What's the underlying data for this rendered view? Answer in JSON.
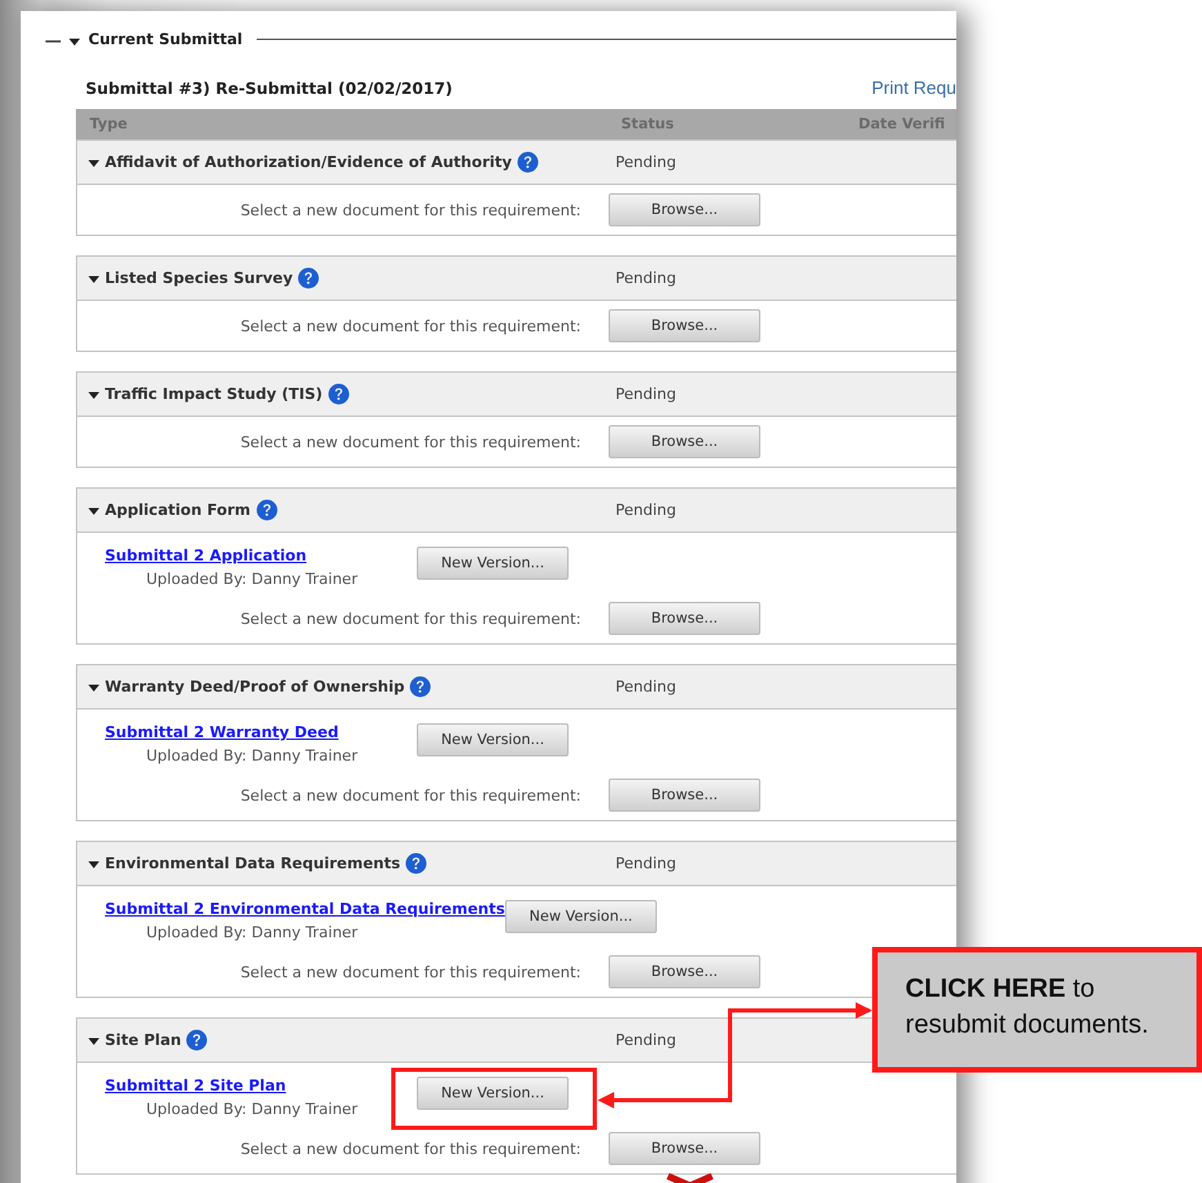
{
  "section": {
    "title": "Current Submittal",
    "expanded": true
  },
  "submittal_title": "Submittal #3) Re-Submittal (02/02/2017)",
  "print_link": "Print Requ",
  "columns": [
    "Type",
    "Status",
    "Date Verifi"
  ],
  "requirements": [
    {
      "name": "Affidavit of Authorization/Evidence of Authority",
      "status": "Pending",
      "expanded": true,
      "select_label": "Select a new document for this requirement:",
      "browse_button": "Browse..."
    },
    {
      "name": "Listed Species Survey",
      "status": "Pending",
      "expanded": true,
      "select_label": "Select a new document for this requirement:",
      "browse_button": "Browse..."
    },
    {
      "name": "Traffic Impact Study (TIS)",
      "status": "Pending",
      "expanded": true,
      "select_label": "Select a new document for this requirement:",
      "browse_button": "Browse..."
    },
    {
      "name": "Application Form",
      "status": "Pending",
      "expanded": true,
      "documents": [
        {
          "link": "Submittal 2 Application",
          "uploaded_by": "Uploaded By: Danny Trainer",
          "button": "New Version..."
        }
      ],
      "select_label": "Select a new document for this requirement:",
      "browse_button": "Browse..."
    },
    {
      "name": "Warranty Deed/Proof of Ownership",
      "status": "Pending",
      "expanded": true,
      "documents": [
        {
          "link": "Submittal 2 Warranty Deed",
          "uploaded_by": "Uploaded By: Danny Trainer",
          "button": "New Version..."
        }
      ],
      "select_label": "Select a new document for this requirement:",
      "browse_button": "Browse..."
    },
    {
      "name": "Environmental Data Requirements",
      "status": "Pending",
      "expanded": true,
      "documents": [
        {
          "link": "Submittal 2 Environmental Data Requirements",
          "uploaded_by": "Uploaded By: Danny Trainer",
          "button": "New Version..."
        }
      ],
      "select_label": "Select a new document for this requirement:",
      "browse_button": "Browse..."
    },
    {
      "name": "Site Plan",
      "status": "Pending",
      "expanded": true,
      "documents": [
        {
          "link": "Submittal 2 Site Plan",
          "uploaded_by": "Uploaded By: Danny Trainer",
          "button": "New Version..."
        }
      ],
      "select_label": "Select a new document for this requirement:",
      "browse_button": "Browse..."
    }
  ],
  "callout": {
    "text": "**CLICK HERE** to resubmit documents."
  }
}
